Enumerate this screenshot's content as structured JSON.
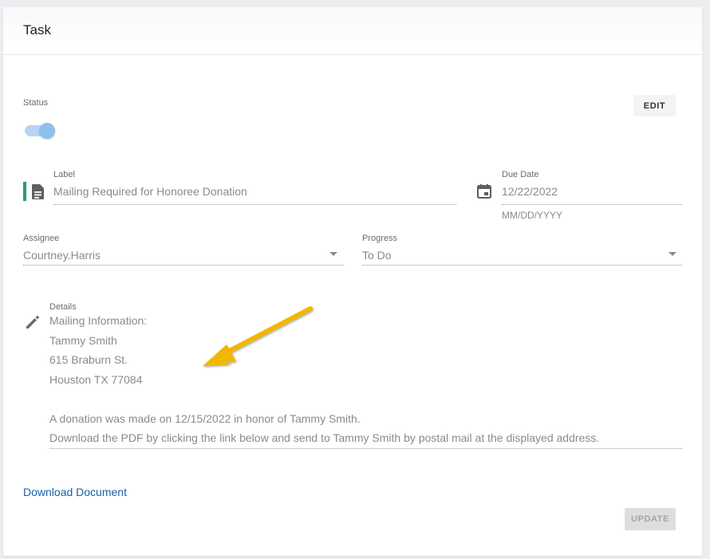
{
  "card": {
    "title": "Task"
  },
  "status": {
    "label": "Status",
    "enabled": true
  },
  "edit_button": {
    "label": "EDIT"
  },
  "label_field": {
    "label": "Label",
    "value": "Mailing Required for Honoree Donation"
  },
  "due_date": {
    "label": "Due Date",
    "value": "12/22/2022",
    "hint": "MM/DD/YYYY"
  },
  "assignee": {
    "label": "Assignee",
    "value": "Courtney.Harris"
  },
  "progress": {
    "label": "Progress",
    "value": "To Do"
  },
  "details": {
    "label": "Details",
    "lines": [
      "Mailing Information:",
      "Tammy Smith",
      "615 Braburn St.",
      "Houston TX 77084",
      "",
      "A donation was made on 12/15/2022 in honor of Tammy Smith.",
      "Download the PDF by clicking the link below and send to Tammy Smith by postal mail at the displayed address."
    ]
  },
  "download_link": {
    "label": "Download Document"
  },
  "update_button": {
    "label": "UPDATE",
    "disabled": true
  },
  "colors": {
    "accent_green": "#1fa463",
    "link_blue": "#1a5fa8",
    "toggle_on": "#8ec0ec",
    "annotation_arrow": "#f2b705"
  },
  "icons": {
    "label_icon": "description-icon",
    "calendar_icon": "event-icon",
    "details_icon": "pencil-icon"
  }
}
